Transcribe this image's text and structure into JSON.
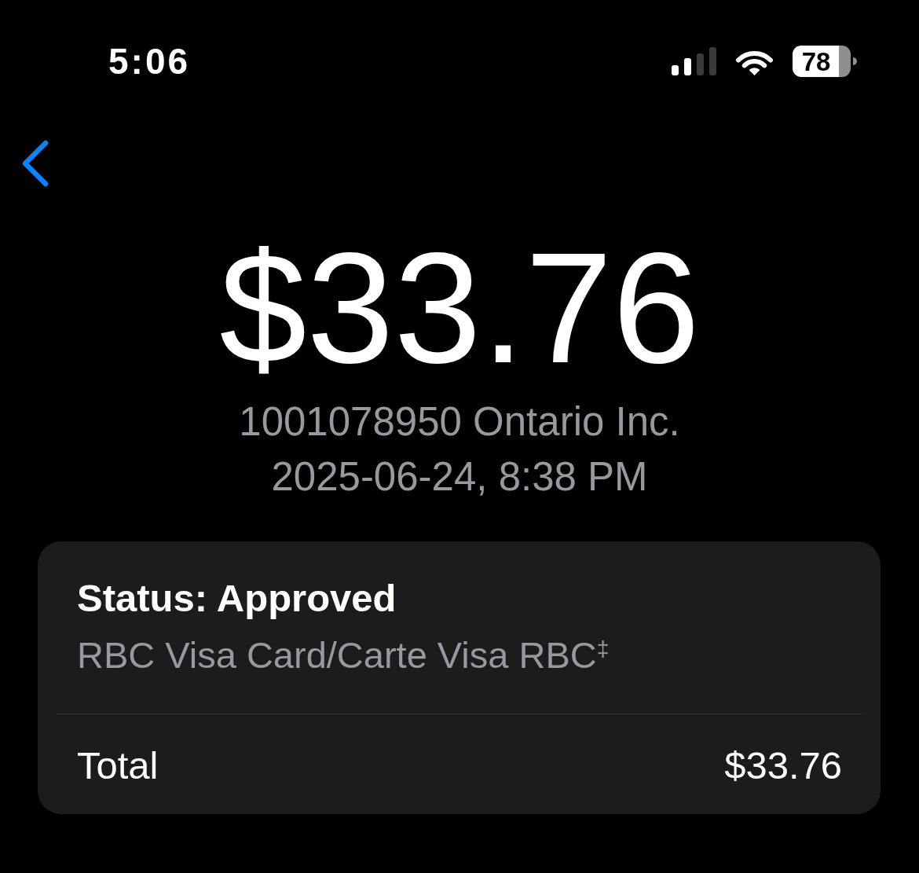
{
  "status_bar": {
    "time": "5:06",
    "battery": "78"
  },
  "transaction": {
    "amount": "$33.76",
    "merchant": "1001078950 Ontario Inc.",
    "date": "2025-06-24, 8:38 PM"
  },
  "details": {
    "status": "Status: Approved",
    "card": "RBC Visa Card/Carte Visa RBC$^{‡}$",
    "total_label": "Total",
    "total_value": "$33.76"
  }
}
